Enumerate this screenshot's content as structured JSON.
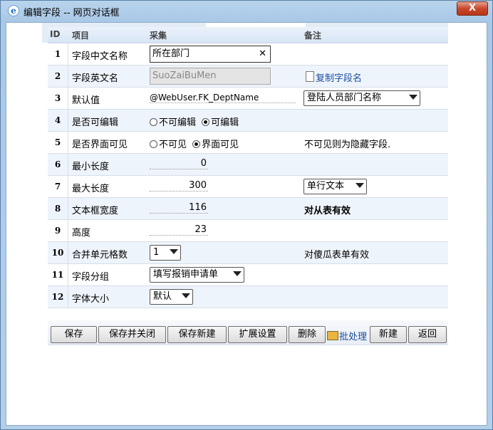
{
  "window": {
    "title": "编辑字段 -- 网页对话框",
    "close_label": "X"
  },
  "table": {
    "headers": {
      "id": "ID",
      "item": "项目",
      "collect": "采集",
      "note": "备注"
    },
    "rows": [
      {
        "id": "1",
        "label": "字段中文名称",
        "value": "所在部门",
        "clear_label": "✕"
      },
      {
        "id": "2",
        "label": "字段英文名",
        "value": "SuoZaiBuMen",
        "link": "复制字段名"
      },
      {
        "id": "3",
        "label": "默认值",
        "value": "@WebUser.FK_DeptName",
        "select": "登陆人员部门名称"
      },
      {
        "id": "4",
        "label": "是否可编辑",
        "option_a": "不可编辑",
        "option_b": "可编辑",
        "selected": "可编辑"
      },
      {
        "id": "5",
        "label": "是否界面可见",
        "option_a": "不可见",
        "option_b": "界面可见",
        "selected": "界面可见",
        "note": "不可见则为隐藏字段."
      },
      {
        "id": "6",
        "label": "最小长度",
        "value": "0"
      },
      {
        "id": "7",
        "label": "最大长度",
        "value": "300",
        "select": "单行文本"
      },
      {
        "id": "8",
        "label": "文本框宽度",
        "value": "116",
        "note": "对从表有效"
      },
      {
        "id": "9",
        "label": "高度",
        "value": "23"
      },
      {
        "id": "10",
        "label": "合并单元格数",
        "select": "1",
        "note": "对傻瓜表单有效"
      },
      {
        "id": "11",
        "label": "字段分组",
        "select": "填写报销申请单"
      },
      {
        "id": "12",
        "label": "字体大小",
        "select": "默认"
      }
    ]
  },
  "toolbar": {
    "save": "保存",
    "save_close": "保存并关闭",
    "save_new": "保存新建",
    "ext_settings": "扩展设置",
    "delete": "删除",
    "batch": "批处理",
    "new": "新建",
    "back": "返回"
  },
  "icons": [
    "ie-icon",
    "close-icon",
    "page-icon",
    "batch-icon",
    "chevron-down-icon"
  ]
}
